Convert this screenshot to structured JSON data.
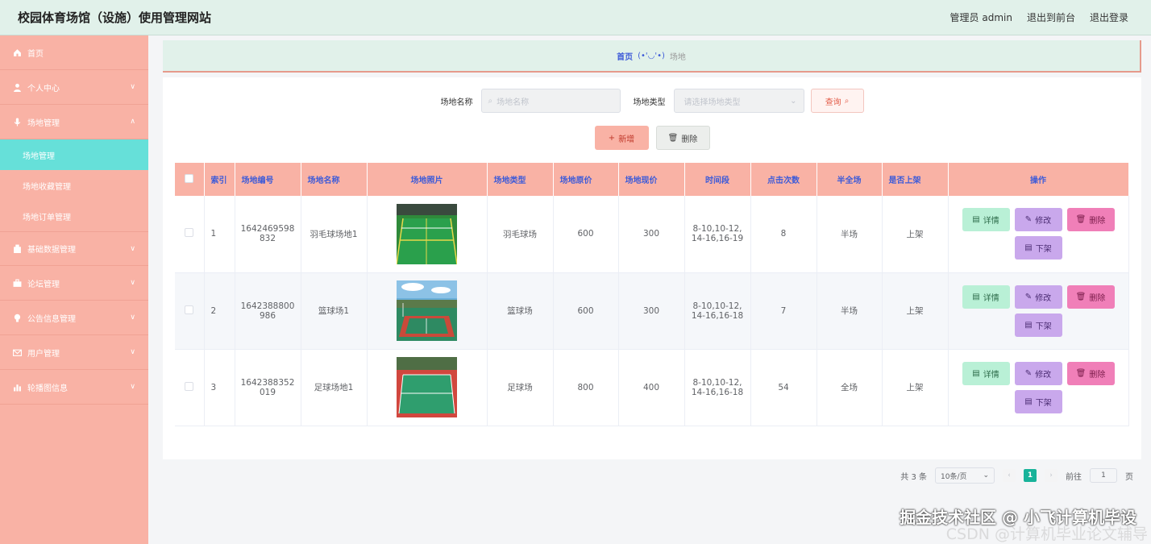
{
  "header": {
    "title": "校园体育场馆（设施）使用管理网站",
    "links": [
      "管理员 admin",
      "退出到前台",
      "退出登录"
    ]
  },
  "sidebar": {
    "items": [
      {
        "label": "首页",
        "icon": "home-icon",
        "chev": ""
      },
      {
        "label": "个人中心",
        "icon": "user-icon",
        "chev": "∨"
      },
      {
        "label": "场地管理",
        "icon": "mic-icon",
        "chev": "∧"
      },
      {
        "label": "基础数据管理",
        "icon": "building-icon",
        "chev": "∨"
      },
      {
        "label": "论坛管理",
        "icon": "briefcase-icon",
        "chev": "∨"
      },
      {
        "label": "公告信息管理",
        "icon": "bulb-icon",
        "chev": "∨"
      },
      {
        "label": "用户管理",
        "icon": "mail-icon",
        "chev": "∨"
      },
      {
        "label": "轮播图信息",
        "icon": "chart-icon",
        "chev": "∨"
      }
    ],
    "subitems": [
      "场地管理",
      "场地收藏管理",
      "场地订单管理"
    ]
  },
  "breadcrumb": {
    "home": "首页",
    "emoji": "(•'◡'•)",
    "current": "场地"
  },
  "search": {
    "name_label": "场地名称",
    "name_placeholder": "场地名称",
    "type_label": "场地类型",
    "type_placeholder": "请选择场地类型",
    "query_label": "查询"
  },
  "actions": {
    "add_label": "新增",
    "delete_label": "删除"
  },
  "table": {
    "headers": [
      "索引",
      "场地编号",
      "场地名称",
      "场地照片",
      "场地类型",
      "场地原价",
      "场地现价",
      "时间段",
      "点击次数",
      "半全场",
      "是否上架",
      "操作"
    ],
    "rows": [
      {
        "index": "1",
        "code": "1642469598832",
        "name": "羽毛球场地1",
        "type": "羽毛球场",
        "orig_price": "600",
        "price": "300",
        "time": "8-10,10-12,14-16,16-19",
        "clicks": "8",
        "half": "半场",
        "shelf": "上架"
      },
      {
        "index": "2",
        "code": "1642388800986",
        "name": "篮球场1",
        "type": "篮球场",
        "orig_price": "600",
        "price": "300",
        "time": "8-10,10-12,14-16,16-18",
        "clicks": "7",
        "half": "半场",
        "shelf": "上架"
      },
      {
        "index": "3",
        "code": "1642388352019",
        "name": "足球场地1",
        "type": "足球场",
        "orig_price": "800",
        "price": "400",
        "time": "8-10,10-12,14-16,16-18",
        "clicks": "54",
        "half": "全场",
        "shelf": "上架"
      }
    ],
    "op_labels": {
      "detail": "详情",
      "edit": "修改",
      "remove": "删除",
      "down": "下架"
    }
  },
  "pager": {
    "total": "共 3 条",
    "size": "10条/页",
    "current": "1",
    "goto": "前往",
    "goto_value": "1",
    "page_unit": "页"
  },
  "watermark": {
    "line1": "掘金技术社区 @ 小飞计算机毕设",
    "line2": "CSDN @计算机毕业论文辅导"
  }
}
